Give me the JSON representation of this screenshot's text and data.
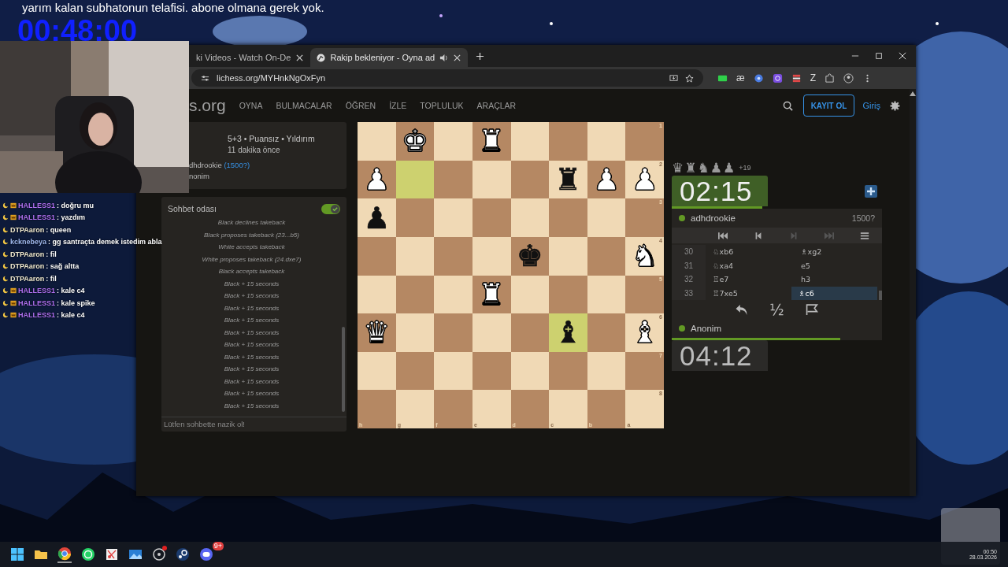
{
  "stream": {
    "title": "yarım kalan subhatonun telafisi. abone olmana gerek yok.",
    "timer": "00:48:00"
  },
  "stream_chat": [
    {
      "user": "HALLESS1",
      "color": "#b070f0",
      "message": ": doğru mu",
      "badges": [
        {
          "kind": "moon"
        },
        {
          "kind": "crown"
        }
      ]
    },
    {
      "user": "HALLESS1",
      "color": "#b070f0",
      "message": ": yazdım",
      "badges": [
        {
          "kind": "moon"
        },
        {
          "kind": "crown"
        }
      ]
    },
    {
      "user": "DTPAaron",
      "color": "#f0ead0",
      "message": ": queen",
      "badges": [
        {
          "kind": "moon"
        }
      ]
    },
    {
      "user": "kcknebeya",
      "color": "#9fb8ee",
      "message": ": gg santraçta demek istedim abla",
      "badges": [
        {
          "kind": "moon"
        }
      ]
    },
    {
      "user": "DTPAaron",
      "color": "#f0ead0",
      "message": ": fil",
      "badges": [
        {
          "kind": "moon"
        }
      ]
    },
    {
      "user": "DTPAaron",
      "color": "#f0ead0",
      "message": ": sağ altta",
      "badges": [
        {
          "kind": "moon"
        }
      ]
    },
    {
      "user": "DTPAaron",
      "color": "#f0ead0",
      "message": ": fil",
      "badges": [
        {
          "kind": "moon"
        }
      ]
    },
    {
      "user": "HALLESS1",
      "color": "#b070f0",
      "message": ": kale c4",
      "badges": [
        {
          "kind": "moon"
        },
        {
          "kind": "crown"
        }
      ]
    },
    {
      "user": "HALLESS1",
      "color": "#b070f0",
      "message": ": kale spike",
      "badges": [
        {
          "kind": "moon"
        },
        {
          "kind": "crown"
        }
      ]
    },
    {
      "user": "HALLESS1",
      "color": "#b070f0",
      "message": ": kale c4",
      "badges": [
        {
          "kind": "moon"
        },
        {
          "kind": "crown"
        }
      ]
    }
  ],
  "browser": {
    "tabs": [
      {
        "title": "ki Videos - Watch On-De",
        "selected": false,
        "audio": false
      },
      {
        "title": "Rakip bekleniyor - Oyna ad",
        "selected": true,
        "audio": true
      }
    ],
    "url": "lichess.org/MYHnkNgOxFyn",
    "extensions": [
      {
        "kind": "badge"
      },
      {
        "kind": "glyph",
        "glyph": "æ"
      },
      {
        "kind": "dot"
      },
      {
        "kind": "play"
      },
      {
        "kind": "stripes"
      },
      {
        "kind": "glyph",
        "glyph": "Z"
      },
      {
        "kind": "puzzle"
      }
    ]
  },
  "site": {
    "logo": "s.org",
    "nav": [
      "OYNA",
      "BULMACALAR",
      "ÖĞREN",
      "İZLE",
      "TOPLULUK",
      "ARAÇLAR"
    ],
    "signup": "KAYIT OL",
    "login": "Giriş"
  },
  "game": {
    "setup": "5+3 • Puansız • Yıldırım",
    "time_ago": "11 dakika önce",
    "player_1": {
      "name": "dhdrookie",
      "rating": "(1500?)"
    },
    "player_2": {
      "name": "nonim"
    }
  },
  "chat": {
    "title": "Sohbet odası",
    "enabled": true,
    "placeholder": "Lütfen sohbette nazik ol!",
    "messages": [
      "Black declines takeback",
      "Black proposes takeback (23...b5)",
      "White accepts takeback",
      "White proposes takeback (24.dxe7)",
      "Black accepts takeback",
      "Black + 15 seconds",
      "Black + 15 seconds",
      "Black + 15 seconds",
      "Black + 15 seconds",
      "Black + 15 seconds",
      "Black + 15 seconds",
      "Black + 15 seconds",
      "Black + 15 seconds",
      "Black + 15 seconds",
      "Black + 15 seconds",
      "Black + 15 seconds"
    ]
  },
  "board": {
    "files": [
      "h",
      "g",
      "f",
      "e",
      "d",
      "c",
      "b",
      "a"
    ],
    "ranks": [
      {
        "label": "1",
        "squares": [
          {
            "highlighted": false
          },
          {
            "piece": "♚",
            "white": true,
            "highlighted": false
          },
          {
            "highlighted": false
          },
          {
            "piece": "♜",
            "white": true,
            "highlighted": false
          },
          {
            "highlighted": false
          },
          {
            "highlighted": false
          },
          {
            "highlighted": false
          },
          {
            "highlighted": false
          }
        ]
      },
      {
        "label": "2",
        "squares": [
          {
            "piece": "♟",
            "white": true,
            "highlighted": false
          },
          {
            "highlighted": true
          },
          {
            "highlighted": false
          },
          {
            "highlighted": false
          },
          {
            "highlighted": false
          },
          {
            "piece": "♜",
            "white": false,
            "highlighted": false
          },
          {
            "piece": "♟",
            "white": true,
            "highlighted": false
          },
          {
            "piece": "♟",
            "white": true,
            "highlighted": false
          }
        ]
      },
      {
        "label": "3",
        "squares": [
          {
            "piece": "♟",
            "white": false,
            "highlighted": false
          },
          {
            "highlighted": false
          },
          {
            "highlighted": false
          },
          {
            "highlighted": false
          },
          {
            "highlighted": false
          },
          {
            "highlighted": false
          },
          {
            "highlighted": false
          },
          {
            "highlighted": false
          }
        ]
      },
      {
        "label": "4",
        "squares": [
          {
            "highlighted": false
          },
          {
            "highlighted": false
          },
          {
            "highlighted": false
          },
          {
            "highlighted": false
          },
          {
            "piece": "♚",
            "white": false,
            "highlighted": false
          },
          {
            "highlighted": false
          },
          {
            "highlighted": false
          },
          {
            "piece": "♞",
            "white": true,
            "highlighted": false
          }
        ]
      },
      {
        "label": "5",
        "squares": [
          {
            "highlighted": false
          },
          {
            "highlighted": false
          },
          {
            "highlighted": false
          },
          {
            "piece": "♜",
            "white": true,
            "highlighted": false
          },
          {
            "highlighted": false
          },
          {
            "highlighted": false
          },
          {
            "highlighted": false
          },
          {
            "highlighted": false
          }
        ]
      },
      {
        "label": "6",
        "squares": [
          {
            "piece": "♛",
            "white": true,
            "highlighted": false
          },
          {
            "highlighted": false
          },
          {
            "highlighted": false
          },
          {
            "highlighted": false
          },
          {
            "highlighted": false
          },
          {
            "piece": "♝",
            "white": false,
            "highlighted": true
          },
          {
            "highlighted": false
          },
          {
            "piece": "♝",
            "white": true,
            "highlighted": false
          }
        ]
      },
      {
        "label": "7",
        "squares": [
          {
            "highlighted": false
          },
          {
            "highlighted": false
          },
          {
            "highlighted": false
          },
          {
            "highlighted": false
          },
          {
            "highlighted": false
          },
          {
            "highlighted": false
          },
          {
            "highlighted": false
          },
          {
            "highlighted": false
          }
        ]
      },
      {
        "label": "8",
        "squares": [
          {
            "highlighted": false
          },
          {
            "highlighted": false
          },
          {
            "highlighted": false
          },
          {
            "highlighted": false
          },
          {
            "highlighted": false
          },
          {
            "highlighted": false
          },
          {
            "highlighted": false
          },
          {
            "highlighted": false
          }
        ]
      }
    ]
  },
  "opponent": {
    "material": [
      "♛",
      "♜",
      "♞",
      "♟",
      "♟"
    ],
    "score": "+19",
    "clock": "02:15",
    "running": true,
    "level": 0.43,
    "name": "adhdrookie",
    "rating": "1500?",
    "online": true
  },
  "move_controls": [
    {
      "kind": "first",
      "disabled": false
    },
    {
      "kind": "prev",
      "disabled": false
    },
    {
      "kind": "next",
      "disabled": true
    },
    {
      "kind": "last",
      "disabled": true
    },
    {
      "kind": "menu",
      "disabled": false
    }
  ],
  "moves": [
    {
      "number": "30",
      "plies": [
        {
          "san": "♘xb6",
          "selected": false
        },
        {
          "san": "♗xg2",
          "selected": false
        }
      ]
    },
    {
      "number": "31",
      "plies": [
        {
          "san": "♘xa4",
          "selected": false
        },
        {
          "san": "e5",
          "selected": false
        }
      ]
    },
    {
      "number": "32",
      "plies": [
        {
          "san": "♖e7",
          "selected": false
        },
        {
          "san": "h3",
          "selected": false
        }
      ]
    },
    {
      "number": "33",
      "plies": [
        {
          "san": "♖7xe5",
          "selected": false
        },
        {
          "san": "♗c6",
          "selected": true
        }
      ]
    }
  ],
  "actions": [
    {
      "kind": "takeback"
    },
    {
      "kind": "draw",
      "glyph": "½"
    },
    {
      "kind": "resign"
    }
  ],
  "player": {
    "name": "Anonim",
    "online": true,
    "level": 0.8,
    "clock": "04:12",
    "running": false
  },
  "taskbar": [
    {
      "kind": "start"
    },
    {
      "kind": "folder"
    },
    {
      "kind": "browser",
      "active": true
    },
    {
      "kind": "phone"
    },
    {
      "kind": "snip"
    },
    {
      "kind": "photos"
    },
    {
      "kind": "ring",
      "dot": true
    },
    {
      "kind": "steam"
    },
    {
      "kind": "discord",
      "badge": "9+"
    }
  ],
  "tray": {
    "time": "00:50",
    "date": "28.03.2026"
  }
}
